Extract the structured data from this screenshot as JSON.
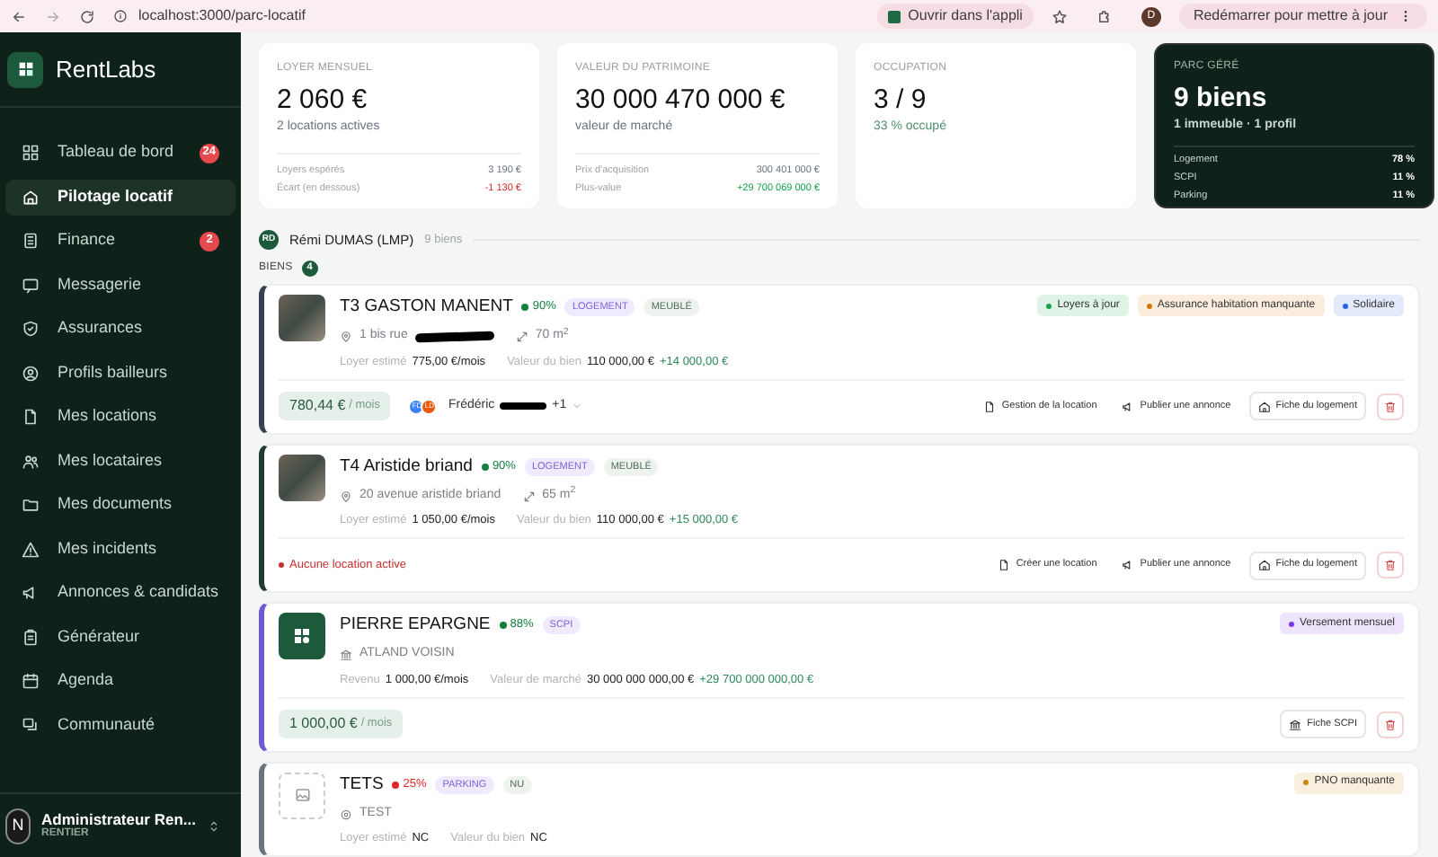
{
  "browser": {
    "url": "localhost:3000/parc-locatif",
    "open_app": "Ouvrir dans l'appli",
    "profile": "D",
    "update": "Redémarrer pour mettre à jour"
  },
  "sidebar": {
    "brand": "RentLabs",
    "items": [
      {
        "label": "Tableau de bord",
        "badge": "24",
        "selected": false
      },
      {
        "label": "Pilotage locatif",
        "selected": true
      },
      {
        "label": "Finance",
        "badge": "2",
        "selected": false
      },
      {
        "label": "Messagerie",
        "selected": false
      },
      {
        "label": "Assurances",
        "selected": false
      },
      {
        "label": "Profils bailleurs",
        "selected": false
      },
      {
        "label": "Mes locations",
        "selected": false
      },
      {
        "label": "Mes locataires",
        "selected": false
      },
      {
        "label": "Mes documents",
        "selected": false
      },
      {
        "label": "Mes incidents",
        "selected": false
      },
      {
        "label": "Annonces & candidats",
        "selected": false
      },
      {
        "label": "Générateur",
        "selected": false
      },
      {
        "label": "Agenda",
        "selected": false
      },
      {
        "label": "Communauté",
        "selected": false
      }
    ],
    "user": {
      "initial": "N",
      "name": "Administrateur Ren...",
      "role": "RENTIER"
    }
  },
  "stats": [
    {
      "kind": "rent",
      "label": "LOYER MENSUEL",
      "value": "2 060 €",
      "sub": "2 locations actives",
      "rows": [
        {
          "label": "Loyers espérés",
          "value": "3 190 €"
        },
        {
          "label": "Écart (en dessous)",
          "value": "-1 130 €"
        }
      ]
    },
    {
      "kind": "patrimony",
      "label": "VALEUR DU PATRIMOINE",
      "value": "30 000 470 000 €",
      "sub": "valeur de marché",
      "rows": [
        {
          "label": "Prix d'acquisition",
          "value": "300 401 000 €"
        },
        {
          "label": "Plus-value",
          "value": "+29 700 069 000 €"
        }
      ]
    },
    {
      "kind": "occupancy",
      "label": "OCCUPATION",
      "value": "3 / 9",
      "sub": "33 % occupé"
    },
    {
      "kind": "portfolio",
      "label": "PARC GÉRÉ",
      "value": "9 biens",
      "sub": "1 immeuble · 1 profil",
      "rows": [
        {
          "label": "Logement",
          "value": "78 %"
        },
        {
          "label": "SCPI",
          "value": "11 %"
        },
        {
          "label": "Parking",
          "value": "11 %"
        }
      ]
    }
  ],
  "owner": {
    "initials": "RD",
    "name": "Rémi DUMAS (LMP)",
    "count": "9 biens"
  },
  "section": {
    "label": "BIENS",
    "count": "4"
  },
  "properties": [
    {
      "kind": "logement",
      "color": "#374151",
      "title": "T3 GASTON MANENT",
      "score": {
        "text": "90%",
        "color": "#15803d"
      },
      "tags": [
        {
          "label": "LOGEMENT",
          "kind": "type"
        },
        {
          "label": "MEUBLÉ",
          "kind": "furnish"
        }
      ],
      "address": {
        "text": "1 bis rue",
        "redacted": true,
        "area": "70 m$^{2}$"
      },
      "meta": [
        {
          "label": "Loyer estimé",
          "value": "775,00 €/mois"
        },
        {
          "label": "Valeur du bien",
          "value": "110 000,00 €",
          "delta": "+14 000,00 €"
        }
      ],
      "badges": [
        {
          "label": "Loyers à jour",
          "color": "#16a34a"
        },
        {
          "label": "Assurance habitation manquante",
          "color": "#d97706"
        },
        {
          "label": "Solidaire",
          "color": "#2563eb"
        }
      ],
      "footer": {
        "rent": {
          "amount": "780,44 €",
          "unit": "/ mois"
        },
        "tenants": {
          "avatars": [
            {
              "initials": "FD",
              "color": "#3b82f6"
            },
            {
              "initials": "LD",
              "color": "#ea580c"
            }
          ],
          "name": "Frédéric",
          "redacted": true,
          "more": "+1"
        },
        "actions": [
          {
            "label": "Gestion de la location",
            "kind": "lease"
          },
          {
            "label": "Publier une annonce",
            "kind": "advert"
          },
          {
            "label": "Fiche du logement",
            "kind": "sheet"
          }
        ]
      }
    },
    {
      "kind": "logement",
      "color": "#1f3d2f",
      "title": "T4 Aristide briand",
      "score": {
        "text": "90%",
        "color": "#15803d"
      },
      "tags": [
        {
          "label": "LOGEMENT",
          "kind": "type"
        },
        {
          "label": "MEUBLÉ",
          "kind": "furnish"
        }
      ],
      "address": {
        "text": "20 avenue aristide briand",
        "area": "65 m$^{2}$"
      },
      "meta": [
        {
          "label": "Loyer estimé",
          "value": "1 050,00 €/mois"
        },
        {
          "label": "Valeur du bien",
          "value": "110 000,00 €",
          "delta": "+15 000,00 €"
        }
      ],
      "footer": {
        "alert": "Aucune location active",
        "actions": [
          {
            "label": "Créer une location",
            "kind": "lease"
          },
          {
            "label": "Publier une annonce",
            "kind": "advert"
          },
          {
            "label": "Fiche du logement",
            "kind": "sheet"
          }
        ]
      }
    },
    {
      "kind": "scpi",
      "color": "#6d5bd0",
      "title": "PIERRE EPARGNE",
      "score": {
        "text": "88%",
        "color": "#15803d"
      },
      "tags": [
        {
          "label": "SCPI",
          "kind": "type"
        }
      ],
      "address": {
        "text": "ATLAND VOISIN"
      },
      "meta": [
        {
          "label": "Revenu",
          "value": "1 000,00 €/mois"
        },
        {
          "label": "Valeur de marché",
          "value": "30 000 000 000,00 €",
          "delta": "+29 700 000 000,00 €"
        }
      ],
      "badges": [
        {
          "label": "Versement mensuel",
          "color": "#7c3aed"
        }
      ],
      "footer": {
        "rent": {
          "amount": "1 000,00 €",
          "unit": "/ mois"
        },
        "actions": [
          {
            "label": "Fiche SCPI",
            "kind": "fund_sheet"
          }
        ]
      }
    },
    {
      "kind": "parking",
      "color": "#6b7280",
      "title": "TETS",
      "score": {
        "text": "25%",
        "color": "#dc2626"
      },
      "tags": [
        {
          "label": "PARKING",
          "kind": "type"
        },
        {
          "label": "NU",
          "kind": "furnish"
        }
      ],
      "address": {
        "text": "TEST"
      },
      "meta": [
        {
          "label": "Loyer estimé",
          "value": "NC"
        },
        {
          "label": "Valeur du bien",
          "value": "NC"
        }
      ],
      "badges": [
        {
          "label": "PNO manquante",
          "color": "#ca8a04"
        }
      ]
    }
  ]
}
